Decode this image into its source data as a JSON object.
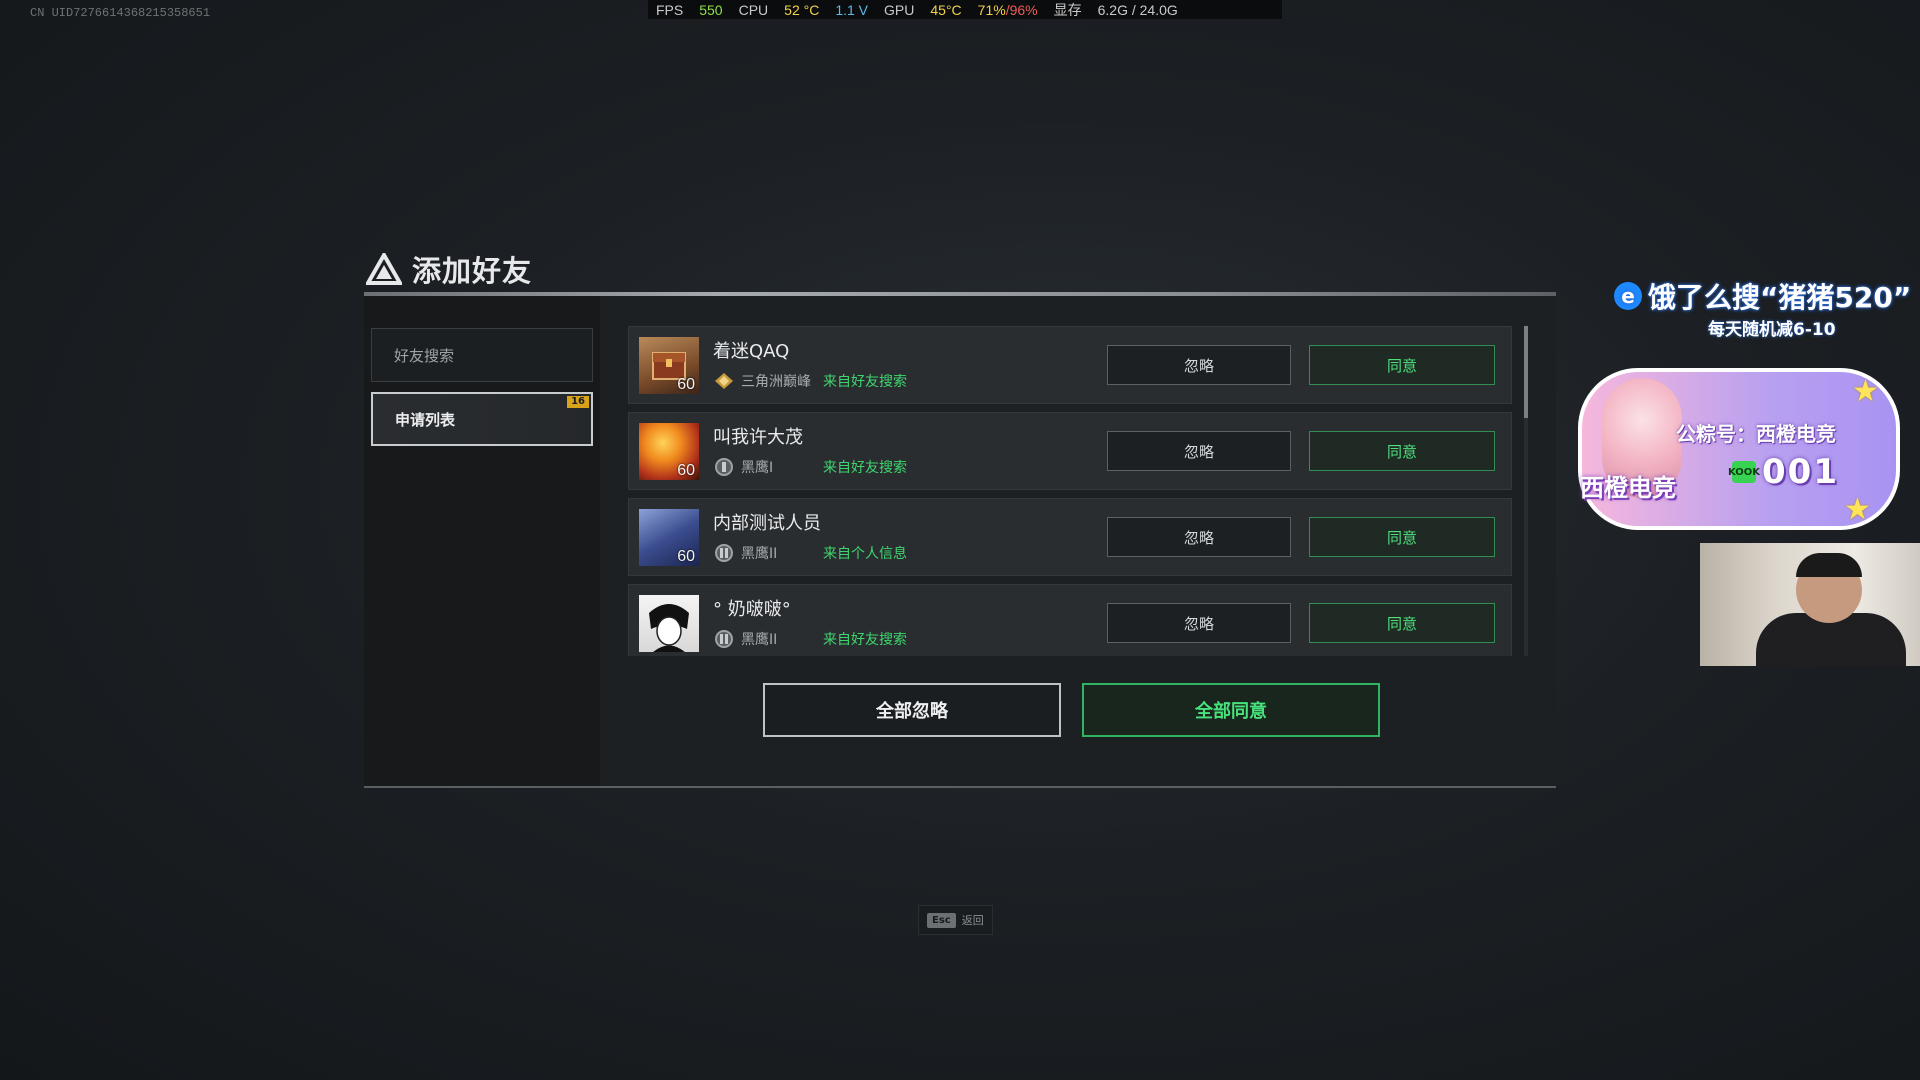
{
  "overlay": {
    "uid": "CN UID7276614368215358651",
    "perf": {
      "fps_label": "FPS",
      "fps_value": "550",
      "cpu_label": "CPU",
      "cpu_temp": "52 °C",
      "cpu_volt": "1.1 V",
      "gpu_label": "GPU",
      "gpu_temp": "45°C",
      "gpu_usage": "71%",
      "gpu_usage2": "/96%",
      "vram_label": "显存",
      "vram_value": "6.2G / 24.0G"
    }
  },
  "dialog": {
    "title": "添加好友",
    "sidebar": {
      "items": [
        {
          "label": "好友搜索",
          "active": false
        },
        {
          "label": "申请列表",
          "active": true,
          "badge": "16"
        }
      ]
    },
    "requests": [
      {
        "name": "着迷QAQ",
        "level": "60",
        "rank": "三角洲巅峰",
        "source": "来自好友搜索",
        "avatar": "avatar-treasure"
      },
      {
        "name": "叫我许大茂",
        "level": "60",
        "rank": "黑鹰I",
        "source": "来自好友搜索",
        "avatar": "avatar-fire"
      },
      {
        "name": "内部测试人员",
        "level": "60",
        "rank": "黑鹰II",
        "source": "来自个人信息",
        "avatar": "avatar-mech"
      },
      {
        "name": "° 奶啵啵°",
        "level": "",
        "rank": "黑鹰II",
        "source": "来自好友搜索",
        "avatar": "avatar-anime"
      }
    ],
    "ignore_label": "忽略",
    "agree_label": "同意",
    "ignore_all_label": "全部忽略",
    "agree_all_label": "全部同意"
  },
  "esc_hint": {
    "key": "Esc",
    "label": "返回"
  },
  "ad": {
    "line1": "饿了么搜“猪猪520”",
    "line2": "每天随机减6-10"
  },
  "streamer_card": {
    "public_account": "公粽号：西橙电竞",
    "name": "西橙电竞",
    "number": "001",
    "number_icon_text": "KOOK"
  },
  "colors": {
    "accent_green": "#3dd66e",
    "panel_bg": "#1d2022",
    "badge": "#d9a21b"
  }
}
